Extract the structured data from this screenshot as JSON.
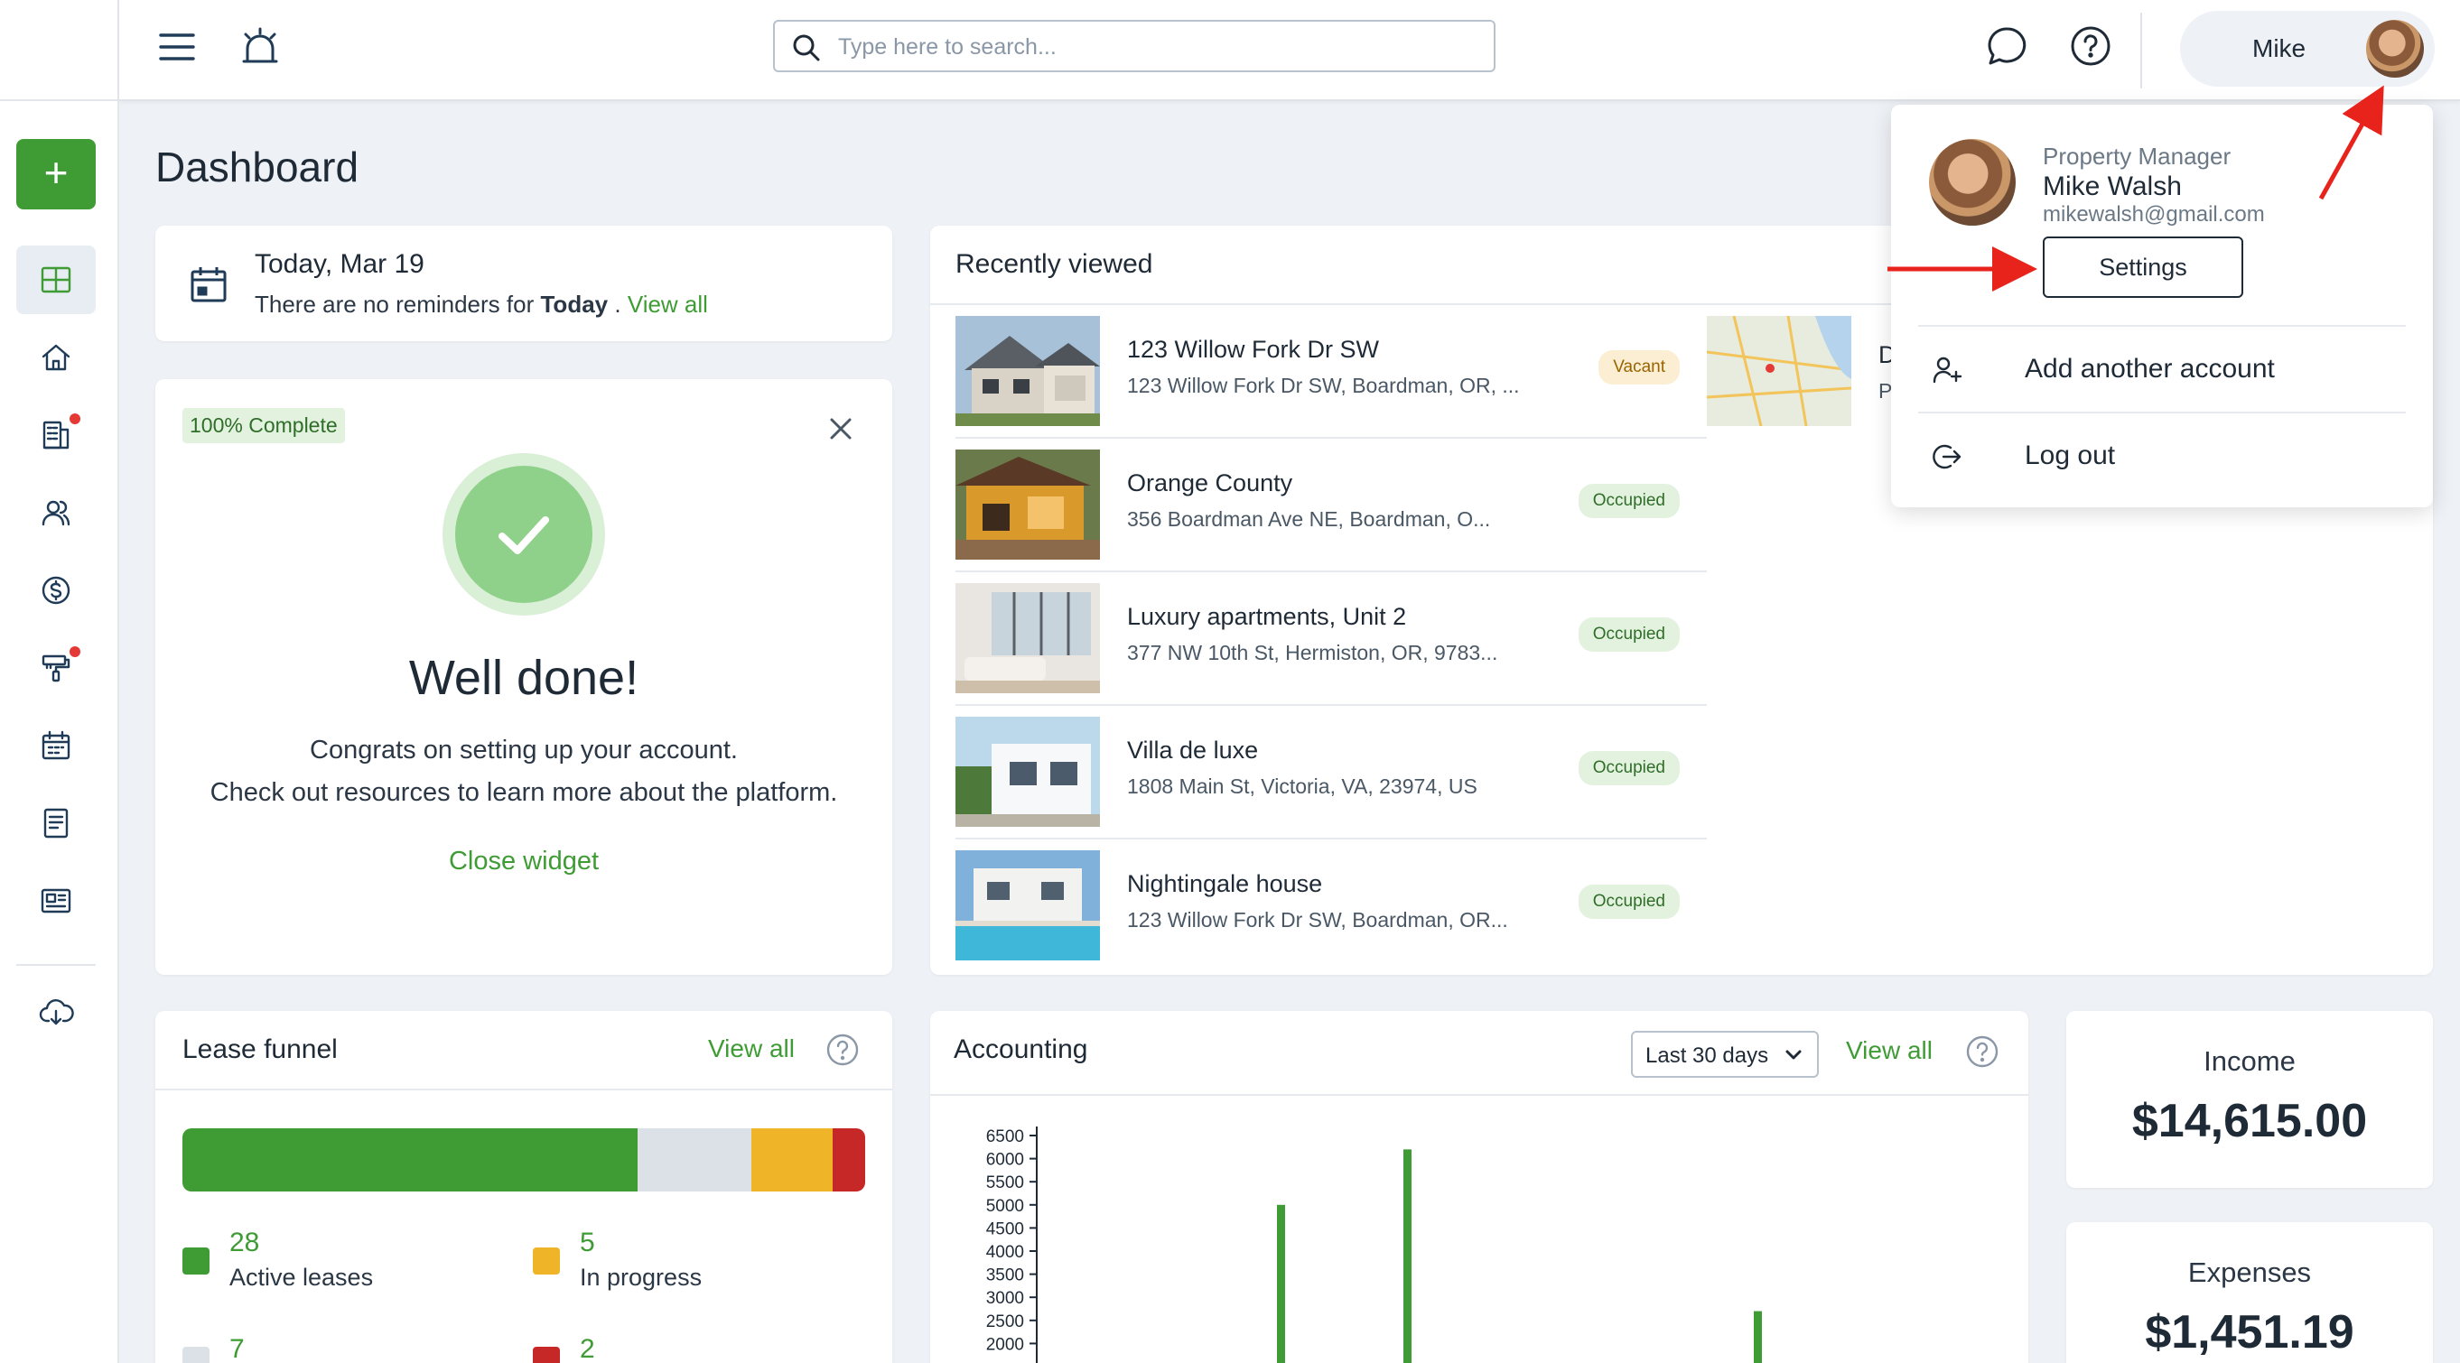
{
  "topbar": {
    "search_placeholder": "Type here to search...",
    "user_name": "Mike"
  },
  "page": {
    "title": "Dashboard"
  },
  "today": {
    "title": "Today, Mar 19",
    "text_prefix": "There are no reminders for",
    "text_bold": "Today",
    "text_suffix": ".",
    "view_all": "View all"
  },
  "welcome": {
    "badge": "100% Complete",
    "title": "Well done!",
    "line1": "Congrats on setting up your account.",
    "line2": "Check out resources to learn more about the platform.",
    "close_label": "Close widget"
  },
  "recent": {
    "title": "Recently viewed",
    "properties": [
      {
        "name": "123 Willow Fork Dr SW",
        "address": "123 Willow Fork Dr SW, Boardman, OR, ...",
        "status": "Vacant"
      },
      {
        "name": "Orange County",
        "address": "356 Boardman Ave NE, Boardman, O...",
        "status": "Occupied"
      },
      {
        "name": "Luxury apartments, Unit 2",
        "address": "377 NW 10th St, Hermiston, OR, 9783...",
        "status": "Occupied"
      },
      {
        "name": "Villa de luxe",
        "address": "1808 Main St, Victoria, VA, 23974, US",
        "status": "Occupied"
      },
      {
        "name": "Nightingale house",
        "address": "123 Willow Fork Dr SW, Boardman, OR...",
        "status": "Occupied"
      }
    ],
    "second_col_name": "D",
    "second_col_addr": "P"
  },
  "lease_funnel": {
    "title": "Lease funnel",
    "view_all": "View all",
    "segments": [
      {
        "label": "Active leases",
        "value": 28,
        "color": "#3f9c35"
      },
      {
        "label": "",
        "value": 7,
        "color": "#dce1e7"
      },
      {
        "label": "In progress",
        "value": 5,
        "color": "#f0b429"
      },
      {
        "label": "",
        "value": 2,
        "color": "#c62828"
      }
    ],
    "legend": [
      {
        "num": "28",
        "label": "Active leases"
      },
      {
        "num": "5",
        "label": "In progress"
      },
      {
        "num": "7",
        "label": ""
      },
      {
        "num": "2",
        "label": ""
      }
    ]
  },
  "accounting": {
    "title": "Accounting",
    "range": "Last 30 days",
    "view_all": "View all"
  },
  "chart_data": {
    "type": "bar",
    "title": "",
    "xlabel": "",
    "ylabel": "",
    "yticks": [
      "6500",
      "6000",
      "5500",
      "5000",
      "4500",
      "4000",
      "3500",
      "3000",
      "2500",
      "2000"
    ],
    "ylim": [
      2000,
      6500
    ],
    "series": [
      {
        "values": [
          5000,
          6200,
          2700
        ],
        "color": "#3f9c35"
      }
    ]
  },
  "income": {
    "label": "Income",
    "value": "$14,615.00"
  },
  "expenses": {
    "label": "Expenses",
    "value": "$1,451.19"
  },
  "dropdown": {
    "role": "Property Manager",
    "name": "Mike Walsh",
    "email": "mikewalsh@gmail.com",
    "settings": "Settings",
    "add_account": "Add another account",
    "logout": "Log out"
  },
  "colors": {
    "accent": "#3f9c35",
    "annotation": "#e8231c"
  },
  "icons": [
    "menu-icon",
    "alarm-icon",
    "search-icon",
    "chat-icon",
    "help-icon",
    "dashboard-icon",
    "home-icon",
    "building-icon",
    "people-icon",
    "dollar-icon",
    "paint-roller-icon",
    "calendar-icon",
    "document-icon",
    "news-icon",
    "download-icon"
  ]
}
